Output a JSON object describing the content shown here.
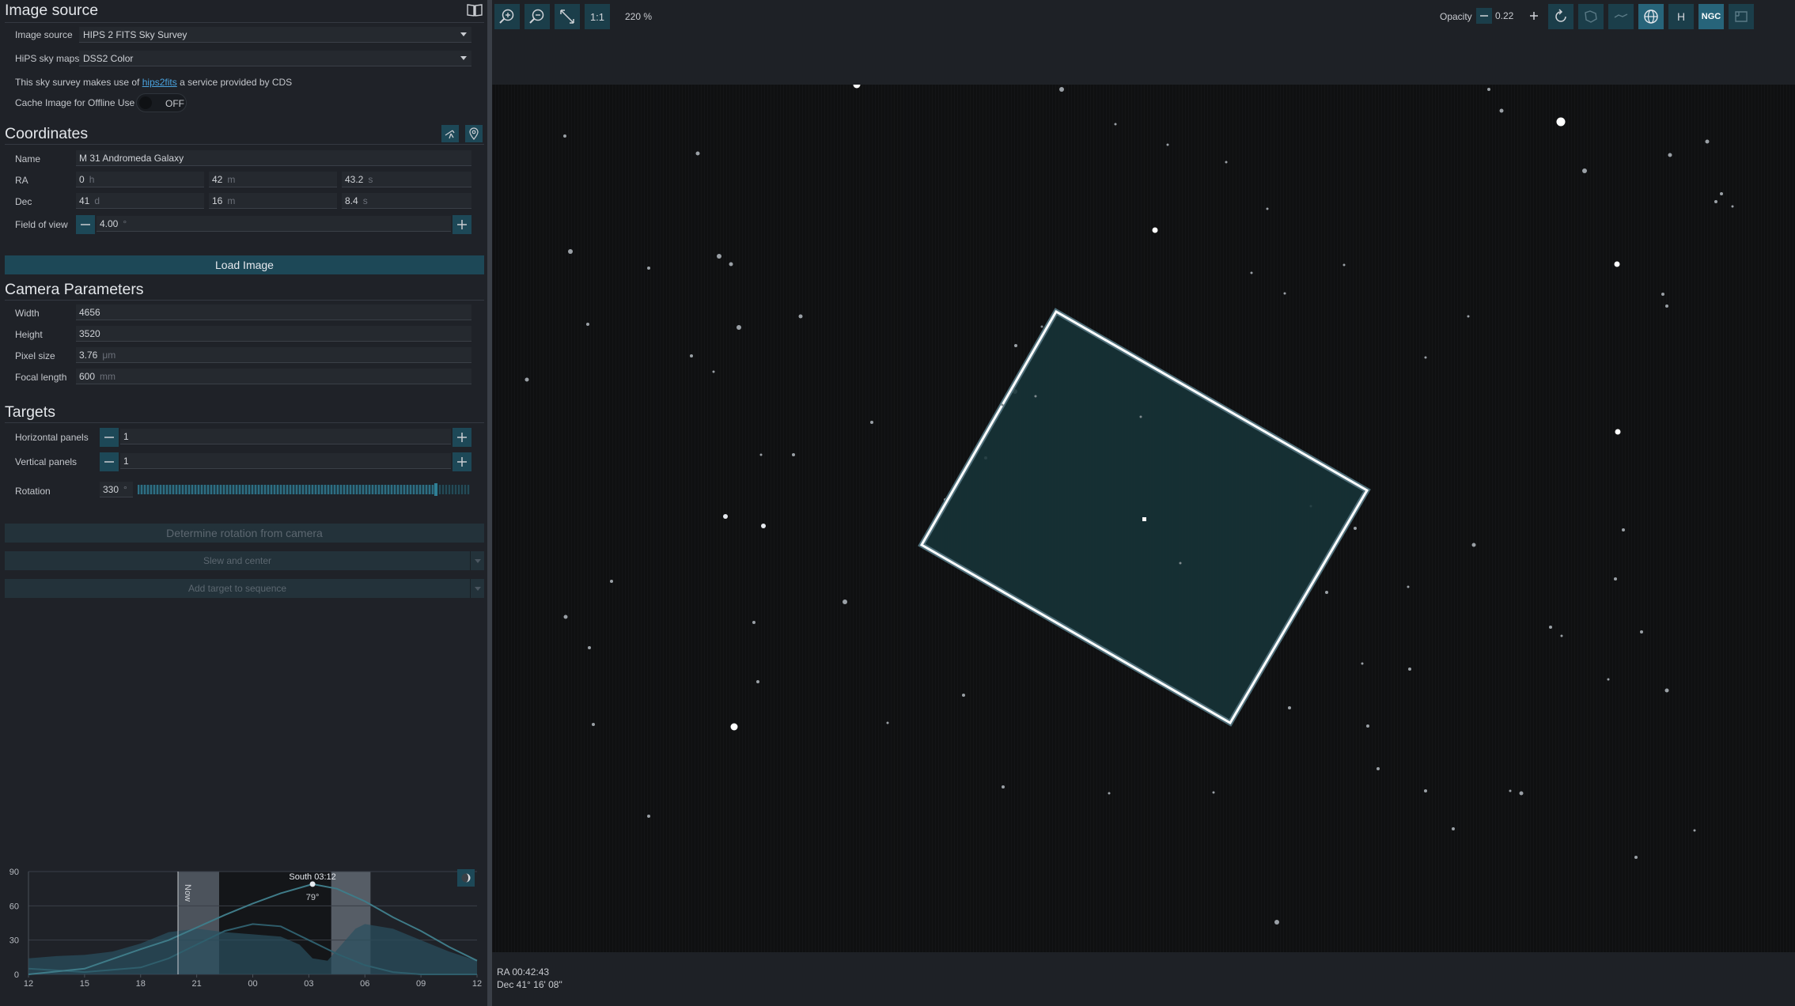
{
  "image_source": {
    "title": "Image source",
    "source_label": "Image source",
    "source_value": "HIPS 2 FITS Sky Survey",
    "hips_label": "HiPS sky maps",
    "hips_value": "DSS2 Color",
    "credit_prefix": "This sky survey makes use of",
    "credit_link": "hips2fits",
    "credit_suffix": "a service provided by CDS",
    "cache_label": "Cache Image for Offline Use",
    "cache_state": "OFF"
  },
  "coordinates": {
    "title": "Coordinates",
    "name_label": "Name",
    "name_value": "M 31 Andromeda Galaxy",
    "ra_label": "RA",
    "ra_h": "0",
    "ra_h_unit": "h",
    "ra_m": "42",
    "ra_m_unit": "m",
    "ra_s": "43.2",
    "ra_s_unit": "s",
    "dec_label": "Dec",
    "dec_d": "41",
    "dec_d_unit": "d",
    "dec_m": "16",
    "dec_m_unit": "m",
    "dec_s": "8.4",
    "dec_s_unit": "s",
    "fov_label": "Field of view",
    "fov_value": "4.00",
    "fov_unit": "°"
  },
  "load_button": "Load Image",
  "camera": {
    "title": "Camera Parameters",
    "width_label": "Width",
    "width_value": "4656",
    "height_label": "Height",
    "height_value": "3520",
    "pixel_label": "Pixel size",
    "pixel_value": "3.76",
    "pixel_unit": "μm",
    "focal_label": "Focal length",
    "focal_value": "600",
    "focal_unit": "mm"
  },
  "targets": {
    "title": "Targets",
    "hpanels_label": "Horizontal panels",
    "hpanels_value": "1",
    "vpanels_label": "Vertical panels",
    "vpanels_value": "1",
    "rotation_label": "Rotation",
    "rotation_value": "330",
    "rotation_unit": "°",
    "rotation_fraction": 0.917,
    "determine_button": "Determine rotation from camera",
    "slew_button": "Slew and center",
    "add_button": "Add target to sequence"
  },
  "chart_data": {
    "type": "area",
    "title": "",
    "y_ticks": [
      "90",
      "60",
      "30",
      "0"
    ],
    "ylim": [
      0,
      90
    ],
    "x_ticks": [
      "12",
      "15",
      "18",
      "21",
      "00",
      "03",
      "06",
      "09",
      "12"
    ],
    "now_label": "Now",
    "transit_label": "South 03:12",
    "transit_alt": "79°",
    "transit_x": 15.2,
    "transit_y": 79,
    "altitude_curve": {
      "x": [
        0,
        3,
        6,
        7.5,
        9,
        10.5,
        12,
        13.5,
        15.2,
        16.5,
        18,
        19.5,
        21,
        22.5,
        24
      ],
      "y": [
        -8,
        5,
        22,
        30,
        41,
        52,
        62,
        71,
        79,
        75,
        64,
        50,
        38,
        24,
        12
      ]
    },
    "horizon_curve": {
      "x": [
        0,
        1.5,
        3,
        4.5,
        6,
        7.5,
        9,
        10.5,
        12,
        13.5,
        14.5,
        15.2,
        16,
        17.5,
        18,
        19.5,
        21,
        22.5,
        24
      ],
      "y": [
        14,
        16,
        17,
        20,
        27,
        37,
        40,
        37,
        35,
        33,
        26,
        14,
        12,
        40,
        44,
        40,
        30,
        20,
        12
      ]
    },
    "moon_curve": {
      "x": [
        0,
        3,
        6,
        7.5,
        9,
        10.5,
        12,
        13.5,
        15,
        16.5,
        18,
        19.5,
        21,
        22.5,
        24
      ],
      "y": [
        5,
        2,
        6,
        14,
        26,
        38,
        44,
        42,
        30,
        18,
        8,
        2,
        -4,
        -8,
        -10
      ]
    },
    "night_spans": [
      [
        8.0,
        10.2
      ],
      [
        16.2,
        18.3
      ]
    ],
    "dark_span": [
      10.2,
      16.2
    ],
    "now_x": 8.0
  },
  "toolbar": {
    "one_to_one": "1:1",
    "zoom": "220 %",
    "opacity_label": "Opacity",
    "opacity_value": "0.22",
    "h_label": "H",
    "ngc_label": "NGC"
  },
  "status": {
    "ra": "RA 00:42:43",
    "dec": "Dec 41° 16' 08\""
  },
  "colors": {
    "accent": "#1d4857",
    "frame": "#ffffff",
    "frame_fill": "#173338"
  }
}
